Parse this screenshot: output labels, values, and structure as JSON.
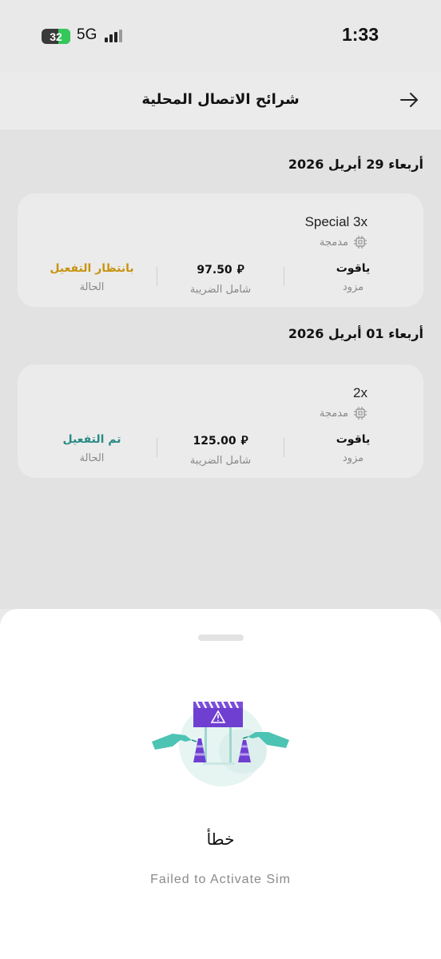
{
  "status_bar": {
    "battery": "32",
    "network": "5G",
    "time": "1:33"
  },
  "header": {
    "title": "شرائح الاتصال المحلية",
    "back_icon": "arrow-right-icon"
  },
  "groups": [
    {
      "date": "أربعاء 29 أبريل 2026",
      "card": {
        "name": "Special 3x",
        "type": "مدمجة",
        "provider": "ياقوت",
        "provider_label": "مزود",
        "price": "97.50",
        "price_label": "شامل الضريبة",
        "status": "بانتظار التفعيل",
        "status_label": "الحالة",
        "status_color": "#c89411"
      }
    },
    {
      "date": "أربعاء 01 أبريل 2026",
      "card": {
        "name": "2x",
        "type": "مدمجة",
        "provider": "ياقوت",
        "provider_label": "مزود",
        "price": "125.00",
        "price_label": "شامل الضريبة",
        "status": "تم التفعيل",
        "status_label": "الحالة",
        "status_color": "#2a8a86"
      }
    }
  ],
  "currency_symbol": "⃁",
  "error_sheet": {
    "title": "خطأ",
    "message": "Failed to Activate Sim"
  }
}
